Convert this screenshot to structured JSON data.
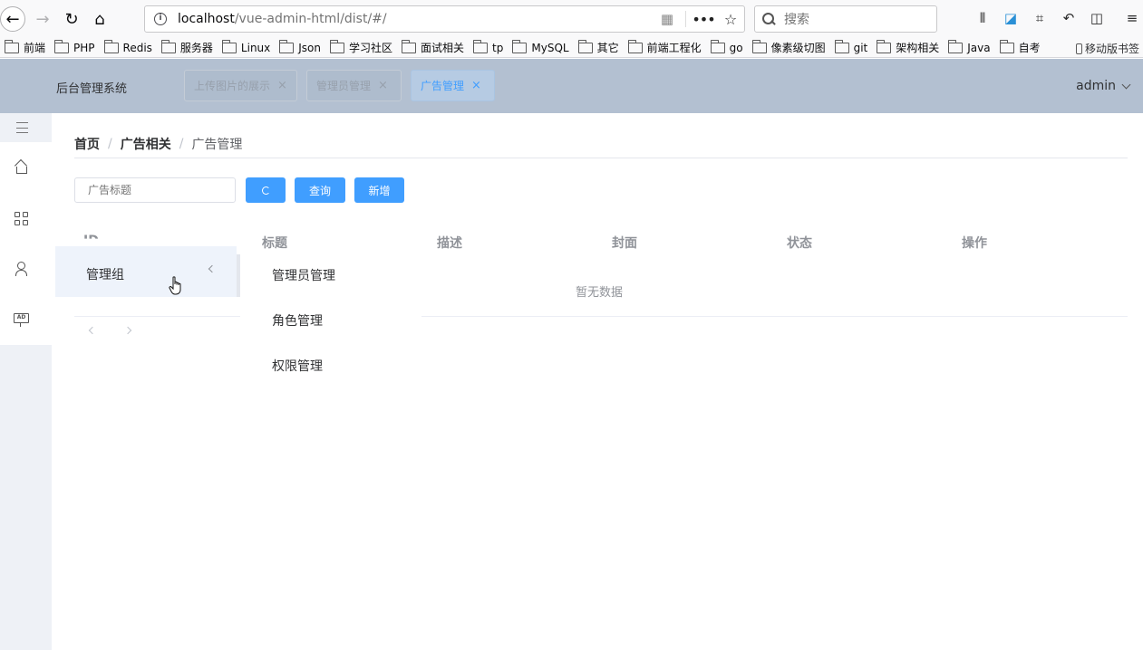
{
  "browser": {
    "url_host": "localhost",
    "url_path": "/vue-admin-html/dist/#/",
    "search_placeholder": "搜索",
    "bookmarks": [
      "前端",
      "PHP",
      "Redis",
      "服务器",
      "Linux",
      "Json",
      "学习社区",
      "面试相关",
      "tp",
      "MySQL",
      "其它",
      "前端工程化",
      "go",
      "像素级切图",
      "git",
      "架构相关",
      "Java",
      "自考"
    ],
    "mobile_bookmarks": "移动版书签"
  },
  "header": {
    "title": "后台管理系统",
    "tags": [
      "上传图片的展示",
      "管理员管理",
      "广告管理"
    ],
    "tag_close": "×",
    "user": "admin"
  },
  "breadcrumb": {
    "home": "首页",
    "section": "广告相关",
    "current": "广告管理",
    "separator": "/"
  },
  "filter": {
    "search_placeholder": "广告标题",
    "query_label": "查询",
    "add_label": "新增"
  },
  "table": {
    "columns": [
      "ID",
      "标题",
      "描述",
      "封面",
      "状态",
      "操作"
    ],
    "empty_text": "暂无数据"
  },
  "menu_popup": {
    "group_label": "管理组",
    "items": [
      "管理员管理",
      "角色管理",
      "权限管理"
    ]
  },
  "colors": {
    "primary": "#409eff",
    "header_bg": "#b3c0d1",
    "sidebar_bg": "#eef1f6"
  }
}
